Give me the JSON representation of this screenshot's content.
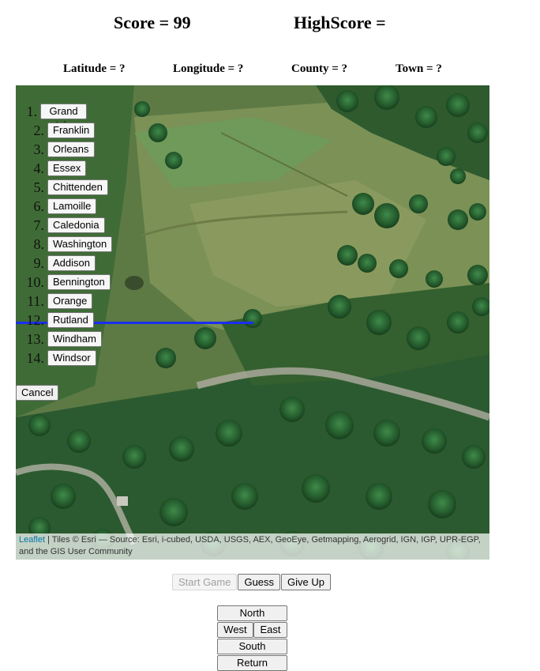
{
  "header": {
    "score": "Score = 99",
    "highscore": "HighScore ="
  },
  "info": {
    "latitude": "Latitude = ?",
    "longitude": "Longitude = ?",
    "county": "County = ?",
    "town": "Town = ?"
  },
  "map": {
    "counties": [
      {
        "num": "1.",
        "label": "Grand Isle"
      },
      {
        "num": "2.",
        "label": "Franklin"
      },
      {
        "num": "3.",
        "label": "Orleans"
      },
      {
        "num": "4.",
        "label": "Essex"
      },
      {
        "num": "5.",
        "label": "Chittenden"
      },
      {
        "num": "6.",
        "label": "Lamoille"
      },
      {
        "num": "7.",
        "label": "Caledonia"
      },
      {
        "num": "8.",
        "label": "Washington"
      },
      {
        "num": "9.",
        "label": "Addison"
      },
      {
        "num": "10.",
        "label": "Bennington"
      },
      {
        "num": "11.",
        "label": "Orange"
      },
      {
        "num": "12.",
        "label": "Rutland"
      },
      {
        "num": "13.",
        "label": "Windham"
      },
      {
        "num": "14.",
        "label": "Windsor"
      }
    ],
    "cancel_label": "Cancel",
    "attribution_link": "Leaflet",
    "attribution_text": " | Tiles © Esri — Source: Esri, i-cubed, USDA, USGS, AEX, GeoEye, Getmapping, Aerogrid, IGN, IGP, UPR-EGP, and the GIS User Community"
  },
  "controls": {
    "start": "Start Game",
    "guess": "Guess",
    "give_up": "Give Up"
  },
  "directions": {
    "north": "North",
    "west": "West",
    "east": "East",
    "south": "South",
    "return": "Return"
  },
  "colors": {
    "guide_line": "#1a2ef0",
    "attribution_link": "#0078a8"
  }
}
